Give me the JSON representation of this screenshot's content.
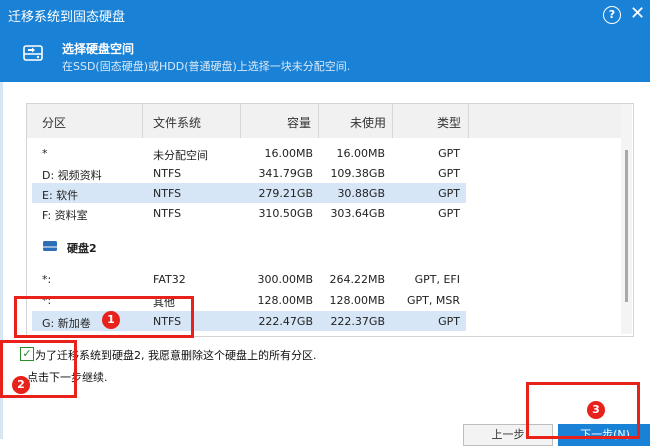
{
  "window": {
    "title": "迁移系统到固态硬盘"
  },
  "header": {
    "title": "选择硬盘空间",
    "subtitle": "在SSD(固态硬盘)或HDD(普通硬盘)上选择一块未分配空间."
  },
  "table": {
    "columns": [
      "分区",
      "文件系统",
      "容量",
      "未使用",
      "类型"
    ],
    "disk1_rows": [
      {
        "partition": "*",
        "fs": "未分配空间",
        "capacity": "16.00MB",
        "unused": "16.00MB",
        "type": "GPT"
      },
      {
        "partition": "D: 视频资料",
        "fs": "NTFS",
        "capacity": "341.79GB",
        "unused": "109.38GB",
        "type": "GPT"
      },
      {
        "partition": "E: 软件",
        "fs": "NTFS",
        "capacity": "279.21GB",
        "unused": "30.88GB",
        "type": "GPT"
      },
      {
        "partition": "F: 资料室",
        "fs": "NTFS",
        "capacity": "310.50GB",
        "unused": "303.64GB",
        "type": "GPT"
      }
    ],
    "disk2_label": "硬盘2",
    "disk2_rows": [
      {
        "partition": "*:",
        "fs": "FAT32",
        "capacity": "300.00MB",
        "unused": "264.22MB",
        "type": "GPT, EFI"
      },
      {
        "partition": "*:",
        "fs": "其他",
        "capacity": "128.00MB",
        "unused": "128.00MB",
        "type": "GPT, MSR"
      },
      {
        "partition": "G: 新加卷",
        "fs": "NTFS",
        "capacity": "222.47GB",
        "unused": "222.37GB",
        "type": "GPT"
      }
    ]
  },
  "confirm": {
    "checked_mark": "✓",
    "text": "为了迁移系统到硬盘2, 我愿意删除这个硬盘上的所有分区.",
    "continue": "点击下一步继续."
  },
  "buttons": {
    "prev": "上一步",
    "next": "下一步(N)"
  },
  "annotations": {
    "badge1": "1",
    "badge2": "2",
    "badge3": "3"
  },
  "colors": {
    "accent": "#1a82d6",
    "annotation": "#e8211b",
    "selected_row": "#d7e6f6"
  },
  "icons": {
    "help": "?",
    "close": "✕"
  }
}
